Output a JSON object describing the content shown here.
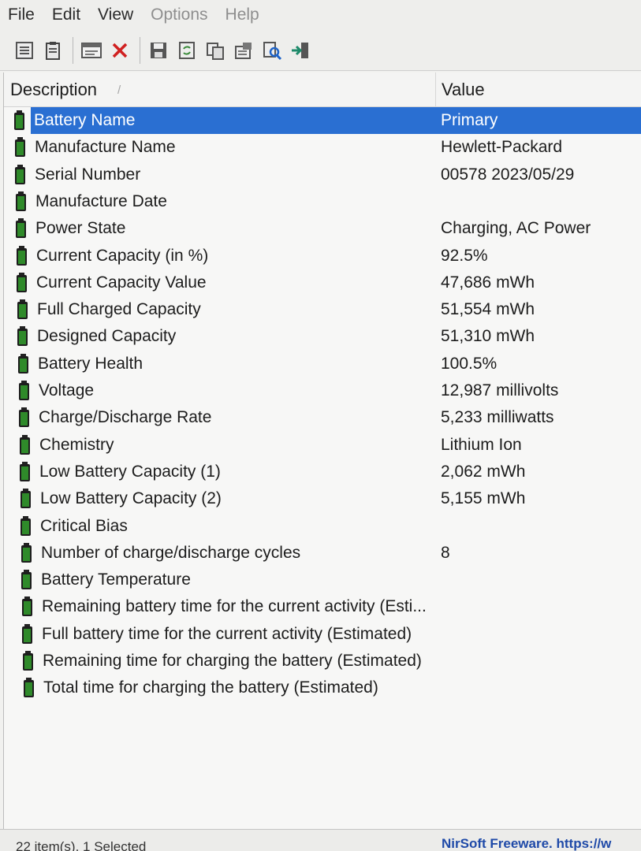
{
  "menu": {
    "file": "File",
    "edit": "Edit",
    "view": "View",
    "options": "Options",
    "help": "Help"
  },
  "toolbar_icons": [
    "html-report-icon",
    "clipboard-icon",
    "properties-icon",
    "delete-icon",
    "save-icon",
    "refresh-icon",
    "copy-icon",
    "settings-icon",
    "find-icon",
    "exit-icon"
  ],
  "columns": {
    "description": "Description",
    "value": "Value"
  },
  "colors": {
    "selection": "#2a6fd2",
    "battery_icon": "#2f8a2a",
    "link": "#1f4aa8"
  },
  "rows": [
    {
      "description": "Battery Name",
      "value": "Primary",
      "selected": true
    },
    {
      "description": "Manufacture Name",
      "value": "Hewlett-Packard"
    },
    {
      "description": "Serial Number",
      "value": "00578 2023/05/29"
    },
    {
      "description": "Manufacture Date",
      "value": ""
    },
    {
      "description": "Power State",
      "value": "Charging, AC Power"
    },
    {
      "description": "Current Capacity (in %)",
      "value": "92.5%"
    },
    {
      "description": "Current Capacity Value",
      "value": "47,686 mWh"
    },
    {
      "description": "Full Charged Capacity",
      "value": "51,554 mWh"
    },
    {
      "description": "Designed Capacity",
      "value": "51,310 mWh"
    },
    {
      "description": "Battery Health",
      "value": "100.5%"
    },
    {
      "description": "Voltage",
      "value": "12,987 millivolts"
    },
    {
      "description": "Charge/Discharge Rate",
      "value": "5,233 milliwatts"
    },
    {
      "description": "Chemistry",
      "value": "Lithium Ion"
    },
    {
      "description": "Low Battery Capacity (1)",
      "value": "2,062 mWh"
    },
    {
      "description": "Low Battery Capacity (2)",
      "value": "5,155 mWh"
    },
    {
      "description": "Critical Bias",
      "value": ""
    },
    {
      "description": "Number of charge/discharge cycles",
      "value": "8"
    },
    {
      "description": "Battery Temperature",
      "value": ""
    },
    {
      "description": "Remaining battery time for the current activity (Esti...",
      "value": ""
    },
    {
      "description": "Full battery time for the current activity (Estimated)",
      "value": ""
    },
    {
      "description": "Remaining time for charging the battery (Estimated)",
      "value": ""
    },
    {
      "description": "Total  time for charging the battery (Estimated)",
      "value": ""
    }
  ],
  "status": {
    "items": "22 item(s), 1 Selected",
    "freeware": "NirSoft Freeware. https://w"
  }
}
